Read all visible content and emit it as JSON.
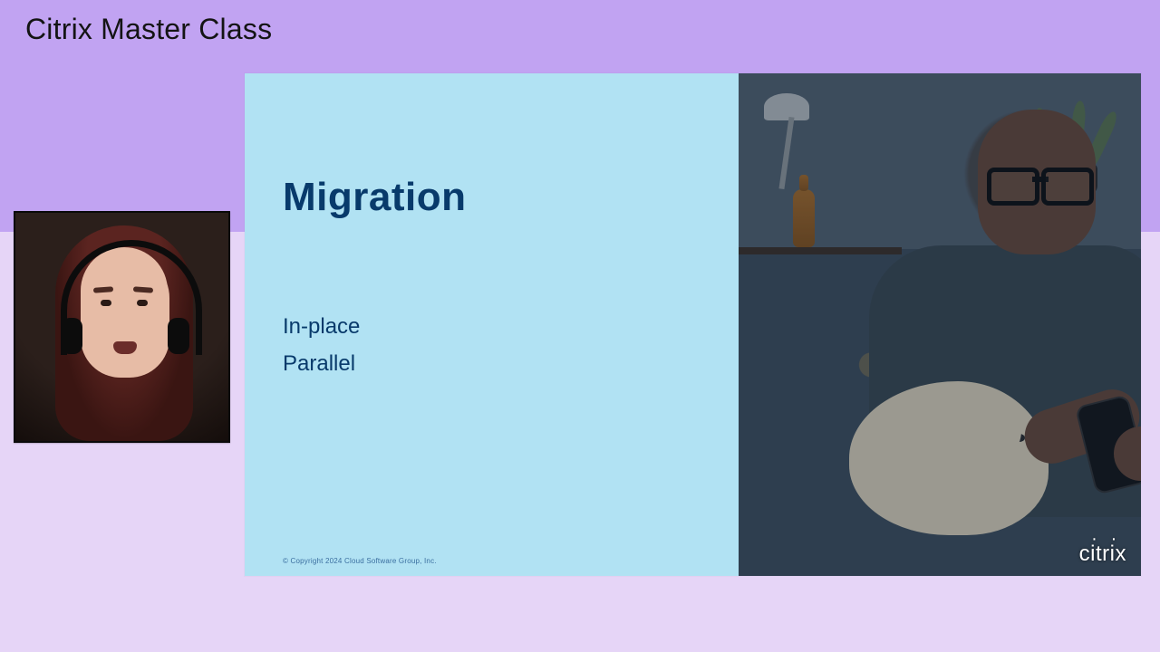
{
  "header": {
    "title": "Citrix Master Class"
  },
  "slide": {
    "title": "Migration",
    "bullets": [
      "In-place",
      "Parallel"
    ],
    "copyright": "© Copyright 2024 Cloud Software Group, Inc.",
    "brand": "citrix"
  }
}
